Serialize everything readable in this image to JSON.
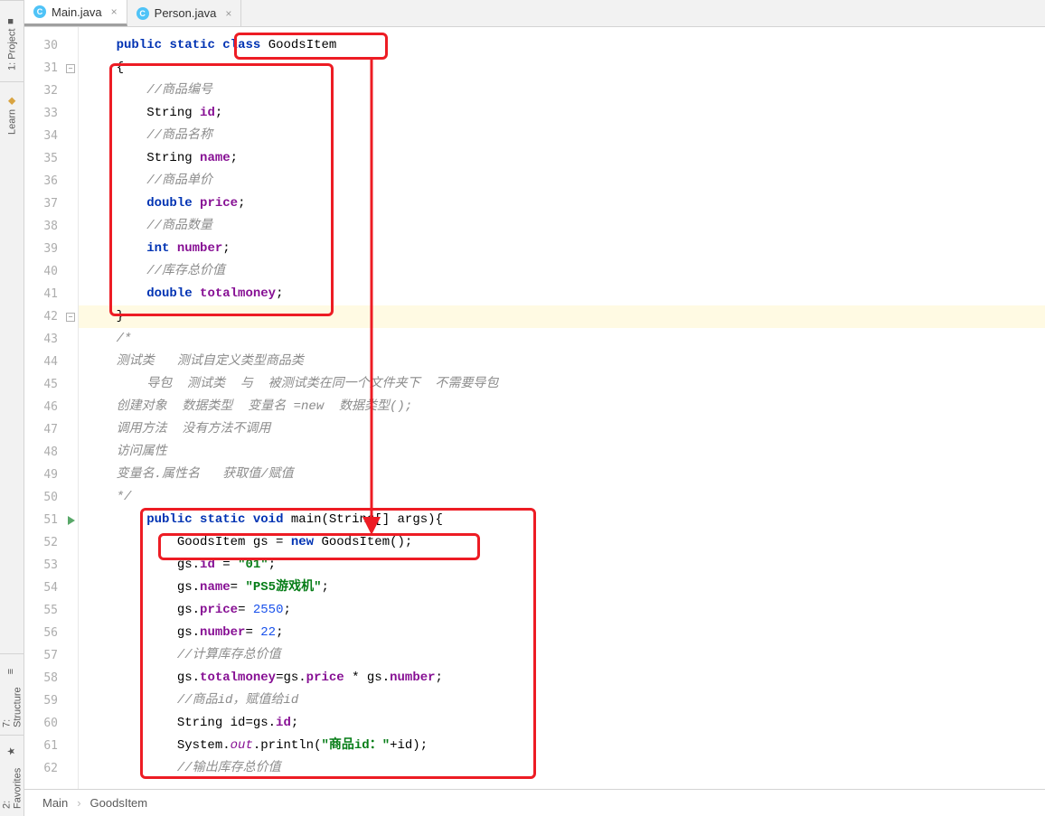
{
  "rail": {
    "project": "1: Project",
    "learn": "Learn",
    "structure": "7: Structure",
    "favorites": "2: Favorites"
  },
  "tabs": [
    {
      "label": "Main.java",
      "active": true
    },
    {
      "label": "Person.java",
      "active": false
    }
  ],
  "lines_start": 30,
  "lines_end": 62,
  "breadcrumb": {
    "a": "Main",
    "b": "GoodsItem"
  },
  "code": {
    "l30": {
      "kw1": "public",
      "kw2": "static",
      "kw3": "class",
      "id": "GoodsItem"
    },
    "l31": {
      "t": "{"
    },
    "l32": {
      "c": "//商品编号"
    },
    "l33": {
      "ty": "String",
      "fld": "id",
      "sc": ";"
    },
    "l34": {
      "c": "//商品名称"
    },
    "l35": {
      "ty": "String",
      "fld": "name",
      "sc": ";"
    },
    "l36": {
      "c": "//商品单价"
    },
    "l37": {
      "kw": "double",
      "fld": "price",
      "sc": ";"
    },
    "l38": {
      "c": "//商品数量"
    },
    "l39": {
      "kw": "int",
      "fld": "number",
      "sc": ";"
    },
    "l40": {
      "c": "//库存总价值"
    },
    "l41": {
      "kw": "double",
      "fld": "totalmoney",
      "sc": ";"
    },
    "l42": {
      "t": "}"
    },
    "l43": {
      "c": "/*"
    },
    "l44": {
      "c": "测试类   测试自定义类型商品类"
    },
    "l45": {
      "c": "    导包  测试类  与  被测试类在同一个文件夹下  不需要导包"
    },
    "l46": {
      "c": "创建对象  数据类型  变量名 =new  数据类型();"
    },
    "l47": {
      "c": "调用方法  没有方法不调用"
    },
    "l48": {
      "c": "访问属性"
    },
    "l49": {
      "c": "变量名.属性名   获取值/赋值"
    },
    "l50": {
      "c": "*/"
    },
    "l51": {
      "kw1": "public",
      "kw2": "static",
      "kw3": "void",
      "m": "main(String[] args){"
    },
    "l52": {
      "a": "GoodsItem gs = ",
      "kw": "new",
      "b": " GoodsItem();"
    },
    "l53": {
      "a": "gs.",
      "fld": "id",
      "b": " = ",
      "str": "\"01\"",
      "sc": ";"
    },
    "l54": {
      "a": "gs.",
      "fld": "name",
      "b": "= ",
      "str": "\"PS5游戏机\"",
      "sc": ";"
    },
    "l55": {
      "a": "gs.",
      "fld": "price",
      "b": "= ",
      "num": "2550",
      "sc": ";"
    },
    "l56": {
      "a": "gs.",
      "fld": "number",
      "b": "= ",
      "num": "22",
      "sc": ";"
    },
    "l57": {
      "c": "//计算库存总价值"
    },
    "l58": {
      "a": "gs.",
      "f1": "totalmoney",
      "b": "=gs.",
      "f2": "price",
      "c": " * gs.",
      "f3": "number",
      "sc": ";"
    },
    "l59": {
      "c": "//商品id，赋值给id"
    },
    "l60": {
      "a": "String id=gs.",
      "fld": "id",
      "sc": ";"
    },
    "l61": {
      "a": "System.",
      "stat": "out",
      "b": ".println(",
      "str": "\"商品id：\"",
      "c": "+id);"
    },
    "l62": {
      "c": "//输出库存总价值"
    }
  }
}
